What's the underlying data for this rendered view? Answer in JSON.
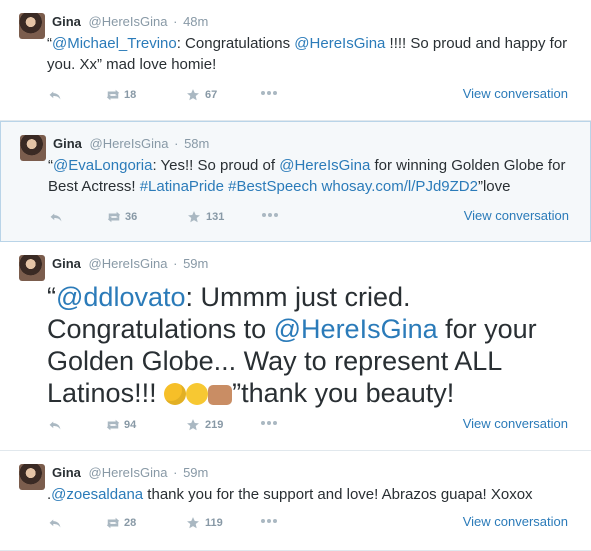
{
  "tweets": [
    {
      "name": "Gina",
      "handle": "@HereIsGina",
      "time": "48m",
      "text": [
        {
          "t": "“",
          "type": "text"
        },
        {
          "t": "@Michael_Trevino",
          "type": "link"
        },
        {
          "t": ": Congratulations ",
          "type": "text"
        },
        {
          "t": "@HereIsGina",
          "type": "link"
        },
        {
          "t": " !!!!  So proud and happy for you.  Xx” mad love homie!",
          "type": "text"
        }
      ],
      "retweets": "18",
      "favorites": "67",
      "view": "View conversation"
    },
    {
      "name": "Gina",
      "handle": "@HereIsGina",
      "time": "58m",
      "text": [
        {
          "t": "“",
          "type": "text"
        },
        {
          "t": "@EvaLongoria",
          "type": "link"
        },
        {
          "t": ": Yes!! So proud of ",
          "type": "text"
        },
        {
          "t": "@HereIsGina",
          "type": "link"
        },
        {
          "t": " for winning Golden Globe for Best Actress! ",
          "type": "text"
        },
        {
          "t": "#LatinaPride",
          "type": "link"
        },
        {
          "t": " ",
          "type": "text"
        },
        {
          "t": "#BestSpeech",
          "type": "link"
        },
        {
          "t": " ",
          "type": "text"
        },
        {
          "t": "whosay.com/l/PJd9ZD2",
          "type": "link"
        },
        {
          "t": "”love",
          "type": "text"
        }
      ],
      "retweets": "36",
      "favorites": "131",
      "view": "View conversation"
    },
    {
      "name": "Gina",
      "handle": "@HereIsGina",
      "time": "59m",
      "text": [
        {
          "t": "“",
          "type": "text"
        },
        {
          "t": "@ddlovato",
          "type": "link"
        },
        {
          "t": ": Ummm just cried. Congratulations to ",
          "type": "text"
        },
        {
          "t": "@HereIsGina",
          "type": "link"
        },
        {
          "t": " for your Golden Globe... Way to represent ALL Latinos!!! ",
          "type": "text"
        },
        {
          "t": "",
          "type": "emoji1"
        },
        {
          "t": "",
          "type": "emoji2"
        },
        {
          "t": "",
          "type": "emoji3"
        },
        {
          "t": "”thank you beauty!",
          "type": "text"
        }
      ],
      "retweets": "94",
      "favorites": "219",
      "view": "View conversation"
    },
    {
      "name": "Gina",
      "handle": "@HereIsGina",
      "time": "59m",
      "text": [
        {
          "t": ".",
          "type": "text"
        },
        {
          "t": "@zoesaldana",
          "type": "link"
        },
        {
          "t": " thank you for the support and love! Abrazos guapa! Xoxox",
          "type": "text"
        }
      ],
      "retweets": "28",
      "favorites": "119",
      "view": "View conversation"
    }
  ],
  "icons": {
    "reply": "reply-icon",
    "retweet": "retweet-icon",
    "favorite": "star-icon",
    "more": "more-icon"
  }
}
